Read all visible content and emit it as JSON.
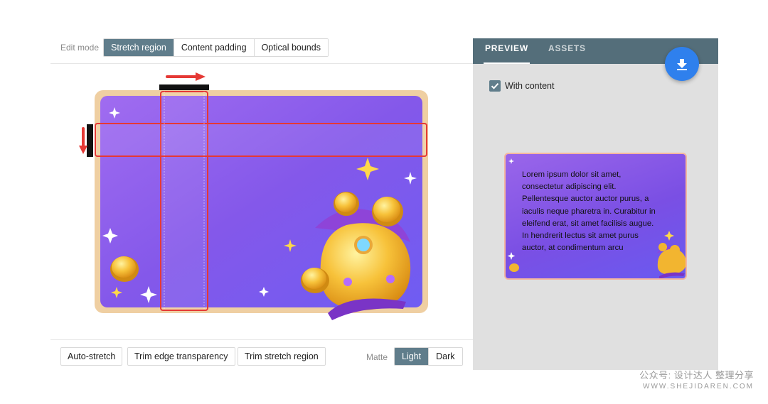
{
  "editor": {
    "edit_mode_label": "Edit mode",
    "modes": [
      "Stretch region",
      "Content padding",
      "Optical bounds"
    ],
    "active_mode": "Stretch region",
    "bottom_buttons": [
      "Auto-stretch",
      "Trim edge transparency",
      "Trim stretch region"
    ],
    "matte_label": "Matte",
    "matte_options": [
      "Light",
      "Dark"
    ],
    "active_matte": "Light"
  },
  "preview": {
    "tabs": [
      "PREVIEW",
      "ASSETS"
    ],
    "active_tab": "PREVIEW",
    "with_content_label": "With content",
    "with_content_checked": true,
    "sample_text": "Lorem ipsum dolor sit amet, consectetur adipiscing elit. Pellentesque auctor auctor purus, a iaculis neque pharetra in. Curabitur in eleifend erat, sit amet facilisis augue. In hendrerit lectus sit amet purus auctor, at condimentum arcu",
    "download_icon": "download-icon"
  },
  "watermark": {
    "line1": "公众号: 设计达人 整理分享",
    "line2": "WWW.SHEJIDAREN.COM"
  },
  "colors": {
    "accent": "#607d8b",
    "tab_bar": "#546e7a",
    "fab": "#2f80ed",
    "stretch_marker": "#e53935",
    "card_purple": "#8a5cf0"
  }
}
